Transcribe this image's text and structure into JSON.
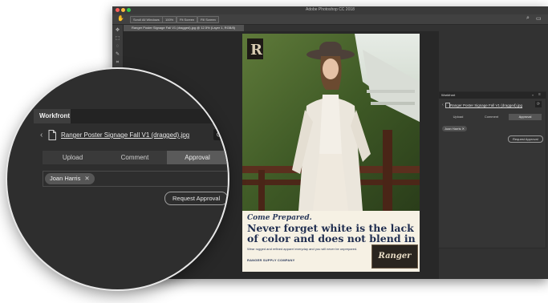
{
  "app": {
    "title": "Adobe Photoshop CC 2018",
    "options": [
      "Scroll All Windows",
      "100%",
      "Fit Screen",
      "Fill Screen"
    ],
    "document_tab": "Ranger Poster Signage Fall V1 (dragged).jpg @ 12.5% (Layer 1, RGB/8)"
  },
  "poster": {
    "tagline": "Come Prepared.",
    "headline": "Never forget white is the lack of color and does not blend in",
    "body": "Wear rugged and refined apparel everyday and you will never be unprepared.",
    "company": "RANGER SUPPLY COMPANY",
    "brand": "Ranger"
  },
  "workfront_small": {
    "tab": "Workfront",
    "file_name": "Ranger Poster Signage Fall V1 (dragged).jpg",
    "tabs": [
      "Upload",
      "Comment",
      "Approval"
    ],
    "approver": "Joan Harris",
    "request_label": "Request Approval"
  },
  "workfront_zoom": {
    "tab": "Workfront",
    "collapse": "»",
    "file_name": "Ranger Poster Signage Fall V1 (dragged).jpg",
    "tabs": [
      "Upload",
      "Comment",
      "Approval"
    ],
    "approver": "Joan Harris",
    "remove_glyph": "✕",
    "request_label": "Request Approval"
  },
  "colors": {
    "ui_dark": "#323232",
    "canvas": "#282828",
    "poster_navy": "#1f2d4f",
    "poster_cream": "#f6f1e4"
  }
}
